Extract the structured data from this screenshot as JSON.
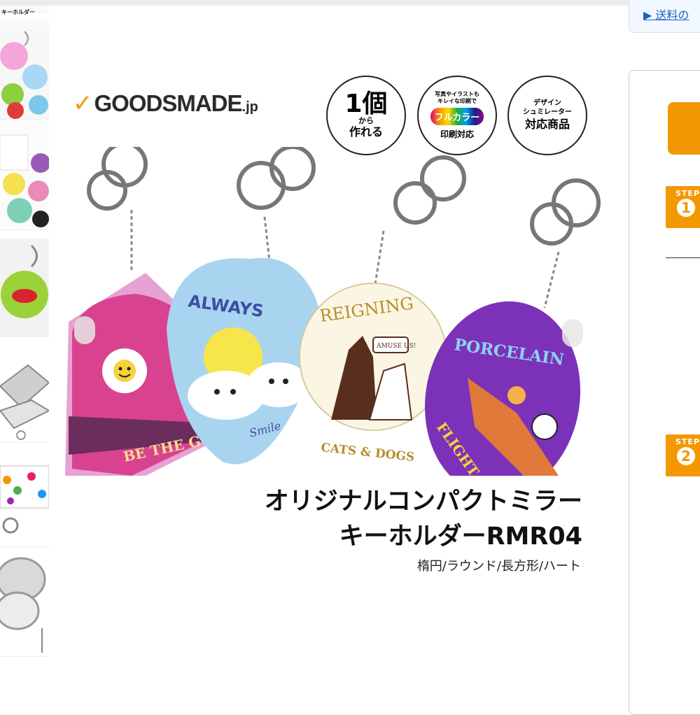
{
  "page": {
    "shipping_link": "▶ 送料の"
  },
  "logo": {
    "check": "✓",
    "brand": "GOODSMADE",
    "tld": ".jp"
  },
  "badges": {
    "one": {
      "big": "1個",
      "small": "から",
      "mid": "作れる"
    },
    "two": {
      "line1": "写真やイラストも",
      "line2": "キレイな印刷で",
      "pill": "フルカラー",
      "bottom": "印刷対応"
    },
    "three": {
      "line1": "デザイン",
      "line2": "シュミレーター",
      "mid": "対応商品"
    }
  },
  "product": {
    "title_line1": "オリジナルコンパクトミラー",
    "title_line2": "キーホルダーRMR04",
    "subtitle": "楕円/ラウンド/長方形/ハート",
    "mirror_texts": {
      "rect": "BE THE GOOD",
      "heart_top": "ALWAYS",
      "heart_bottom": "Smile",
      "round_top": "REIGNING",
      "round_bottom": "CATS & DOGS",
      "round_bubble": "AMUSE US!",
      "oval_top": "PORCELAIN",
      "oval_bottom": "FLIGHT SCHOOL"
    }
  },
  "thumbnails": {
    "first_caption": "キーホルダー"
  },
  "steps": [
    {
      "label": "STEP",
      "number": "1"
    },
    {
      "label": "STEP",
      "number": "2"
    }
  ],
  "colors": {
    "accent": "#f39800",
    "link": "#1a62c7"
  }
}
